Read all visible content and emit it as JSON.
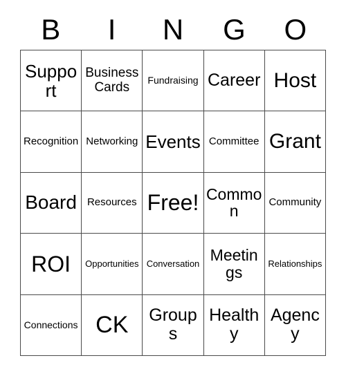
{
  "card": {
    "title_letters": [
      "B",
      "I",
      "N",
      "G",
      "O"
    ],
    "free_space_label": "Free!",
    "border_color": "#4a4a4a",
    "background_color": "#ffffff",
    "text_color": "#000000",
    "columns": 5,
    "rows": 5,
    "cells": [
      [
        {
          "label": "Support",
          "size": "fs-mdl",
          "lines": 1
        },
        {
          "label": "Business Cards",
          "size": "fs-two",
          "lines": 2
        },
        {
          "label": "Fundraising",
          "size": "fs-xxs",
          "lines": 1
        },
        {
          "label": "Career",
          "size": "fs-sm",
          "lines": 1
        },
        {
          "label": "Host",
          "size": "fs-lg",
          "lines": 1
        }
      ],
      [
        {
          "label": "Recognition",
          "size": "fs-xs",
          "lines": 1
        },
        {
          "label": "Networking",
          "size": "fs-xs",
          "lines": 1
        },
        {
          "label": "Events",
          "size": "fs-mdl",
          "lines": 1
        },
        {
          "label": "Committee",
          "size": "fs-xs",
          "lines": 1
        },
        {
          "label": "Grant",
          "size": "fs-lg",
          "lines": 1
        }
      ],
      [
        {
          "label": "Board",
          "size": "fs-md",
          "lines": 1
        },
        {
          "label": "Resources",
          "size": "fs-xs",
          "lines": 1
        },
        {
          "label": "Free!",
          "size": "fs-xl",
          "lines": 1
        },
        {
          "label": "Common",
          "size": "fs-smr",
          "lines": 1
        },
        {
          "label": "Community",
          "size": "fs-xs",
          "lines": 1
        }
      ],
      [
        {
          "label": "ROI",
          "size": "fs-xl",
          "lines": 1
        },
        {
          "label": "Opportunities",
          "size": "fs-tiny",
          "lines": 1
        },
        {
          "label": "Conversation",
          "size": "fs-tiny",
          "lines": 1
        },
        {
          "label": "Meetings",
          "size": "fs-smr",
          "lines": 1
        },
        {
          "label": "Relationships",
          "size": "fs-tiny",
          "lines": 1
        }
      ],
      [
        {
          "label": "Connections",
          "size": "fs-xxs",
          "lines": 1
        },
        {
          "label": "CK",
          "size": "fs-xxl",
          "lines": 1
        },
        {
          "label": "Groups",
          "size": "fs-sm",
          "lines": 1
        },
        {
          "label": "Healthy",
          "size": "fs-sm",
          "lines": 1
        },
        {
          "label": "Agency",
          "size": "fs-sm",
          "lines": 1
        }
      ]
    ]
  }
}
